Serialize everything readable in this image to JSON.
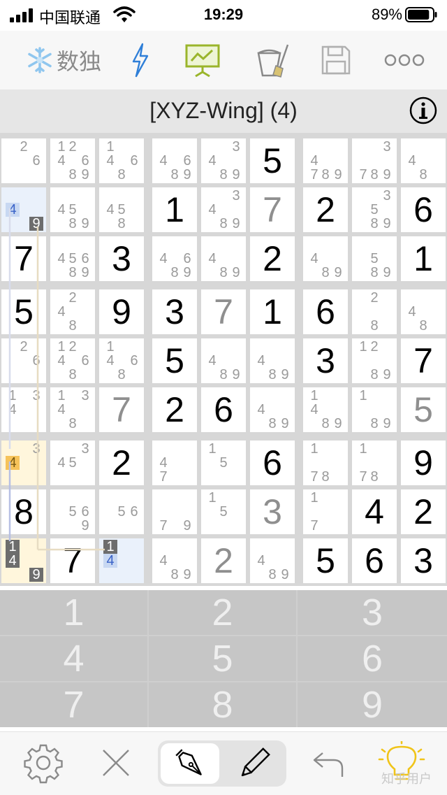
{
  "status": {
    "carrier": "中国联通",
    "time": "19:29",
    "battery": "89%",
    "battery_level": 0.89
  },
  "toolbar": {
    "logo_text": "数独",
    "items": [
      "snowflake-logo",
      "lightning-icon",
      "presentation-icon",
      "clear-icon",
      "save-icon",
      "more-icon"
    ]
  },
  "title": "[XYZ-Wing] (4)",
  "grid": [
    [
      {
        "c": "2,6"
      },
      {
        "c": "1,2,4,6,8,9"
      },
      {
        "c": "1,4,6,8"
      },
      {
        "c": "4,6,8,9"
      },
      {
        "c": "3,4,8,9"
      },
      {
        "v": "5",
        "t": "given"
      },
      {
        "c": "4,7,8,9"
      },
      {
        "c": "3,7,8,9"
      },
      {
        "c": "4,8"
      }
    ],
    [
      {
        "c": "4,9",
        "bg": "blue",
        "hb": "4",
        "hd": "9"
      },
      {
        "c": "4,5,8,9"
      },
      {
        "c": "4,5,8"
      },
      {
        "v": "1",
        "t": "given"
      },
      {
        "c": "3,4,8,9"
      },
      {
        "v": "7",
        "t": "placed"
      },
      {
        "v": "2",
        "t": "given"
      },
      {
        "c": "3,5,8,9"
      },
      {
        "v": "6",
        "t": "given"
      }
    ],
    [
      {
        "v": "7",
        "t": "given"
      },
      {
        "c": "4,5,6,8,9"
      },
      {
        "v": "3",
        "t": "given"
      },
      {
        "c": "4,6,8,9"
      },
      {
        "c": "4,8,9"
      },
      {
        "v": "2",
        "t": "given"
      },
      {
        "c": "4,8,9"
      },
      {
        "c": "5,8,9"
      },
      {
        "v": "1",
        "t": "given"
      }
    ],
    [
      {
        "v": "5",
        "t": "given"
      },
      {
        "c": "2,4,8"
      },
      {
        "v": "9",
        "t": "given"
      },
      {
        "v": "3",
        "t": "given"
      },
      {
        "v": "7",
        "t": "placed"
      },
      {
        "v": "1",
        "t": "given"
      },
      {
        "v": "6",
        "t": "given"
      },
      {
        "c": "2,8"
      },
      {
        "c": "4,8"
      }
    ],
    [
      {
        "c": "2,6"
      },
      {
        "c": "1,2,4,6,8"
      },
      {
        "c": "1,4,6,8"
      },
      {
        "v": "5",
        "t": "given"
      },
      {
        "c": "4,8,9"
      },
      {
        "c": "4,8,9"
      },
      {
        "v": "3",
        "t": "given"
      },
      {
        "c": "1,2,8,9"
      },
      {
        "v": "7",
        "t": "given"
      }
    ],
    [
      {
        "c": "1,3,4"
      },
      {
        "c": "1,3,4,8"
      },
      {
        "v": "7",
        "t": "placed"
      },
      {
        "v": "2",
        "t": "given"
      },
      {
        "v": "6",
        "t": "given"
      },
      {
        "c": "4,8,9"
      },
      {
        "c": "1,4,8,9"
      },
      {
        "c": "1,8,9"
      },
      {
        "v": "5",
        "t": "placed"
      }
    ],
    [
      {
        "c": "3,4",
        "bg": "yellow",
        "hy": "4"
      },
      {
        "c": "3,4,5"
      },
      {
        "v": "2",
        "t": "given"
      },
      {
        "c": "4,7"
      },
      {
        "c": "1,5"
      },
      {
        "v": "6",
        "t": "given"
      },
      {
        "c": "1,7,8"
      },
      {
        "c": "1,7,8"
      },
      {
        "v": "9",
        "t": "given"
      }
    ],
    [
      {
        "v": "8",
        "t": "given"
      },
      {
        "c": "5,6,9"
      },
      {
        "c": "5,6"
      },
      {
        "c": "7,9"
      },
      {
        "c": "1,5"
      },
      {
        "v": "3",
        "t": "placed"
      },
      {
        "c": "1,7"
      },
      {
        "v": "4",
        "t": "given"
      },
      {
        "v": "2",
        "t": "given"
      }
    ],
    [
      {
        "c": "1,4,9",
        "bg": "yellow",
        "hd": "1,4,9"
      },
      {
        "v": "7",
        "t": "given"
      },
      {
        "c": "1,4",
        "bg": "blue",
        "hd": "1",
        "hb": "4"
      },
      {
        "c": "4,8,9"
      },
      {
        "v": "2",
        "t": "placed"
      },
      {
        "c": "4,8,9"
      },
      {
        "v": "5",
        "t": "given"
      },
      {
        "v": "6",
        "t": "given"
      },
      {
        "v": "3",
        "t": "given"
      }
    ]
  ],
  "keypad": [
    "1",
    "2",
    "3",
    "4",
    "5",
    "6",
    "7",
    "8",
    "9"
  ],
  "bottombar": {
    "items": [
      "gear-icon",
      "close-icon",
      "pen-icon",
      "pencil-icon",
      "undo-icon",
      "lightbulb-icon"
    ]
  },
  "watermark": "知乎用户"
}
